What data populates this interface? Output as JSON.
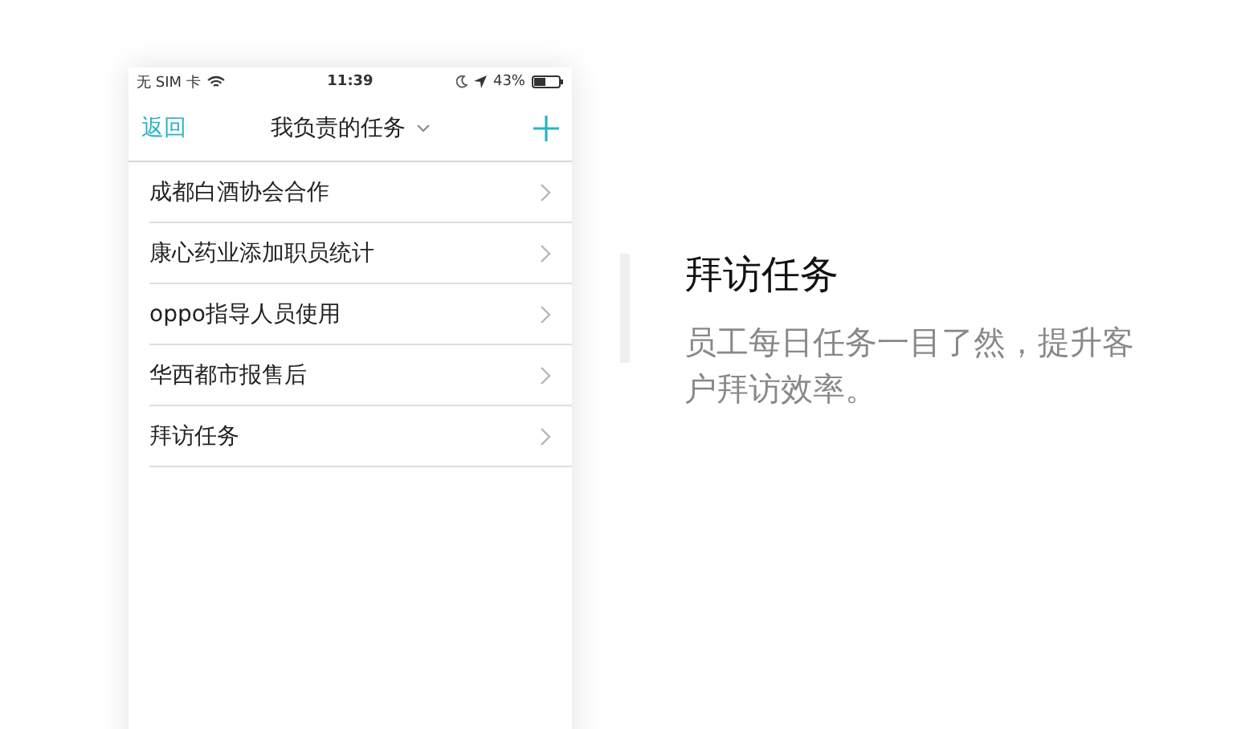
{
  "status_bar": {
    "carrier": "无 SIM 卡",
    "time": "11:39",
    "battery": "43%"
  },
  "nav": {
    "back": "返回",
    "title": "我负责的任务"
  },
  "tasks": [
    {
      "name": "成都白酒协会合作"
    },
    {
      "name": "康心药业添加职员统计"
    },
    {
      "name": "oppo指导人员使用"
    },
    {
      "name": "华西都市报售后"
    },
    {
      "name": "拜访任务"
    }
  ],
  "feature": {
    "title": "拜访任务",
    "description": "员工每日任务一目了然，提升客户拜访效率。"
  }
}
